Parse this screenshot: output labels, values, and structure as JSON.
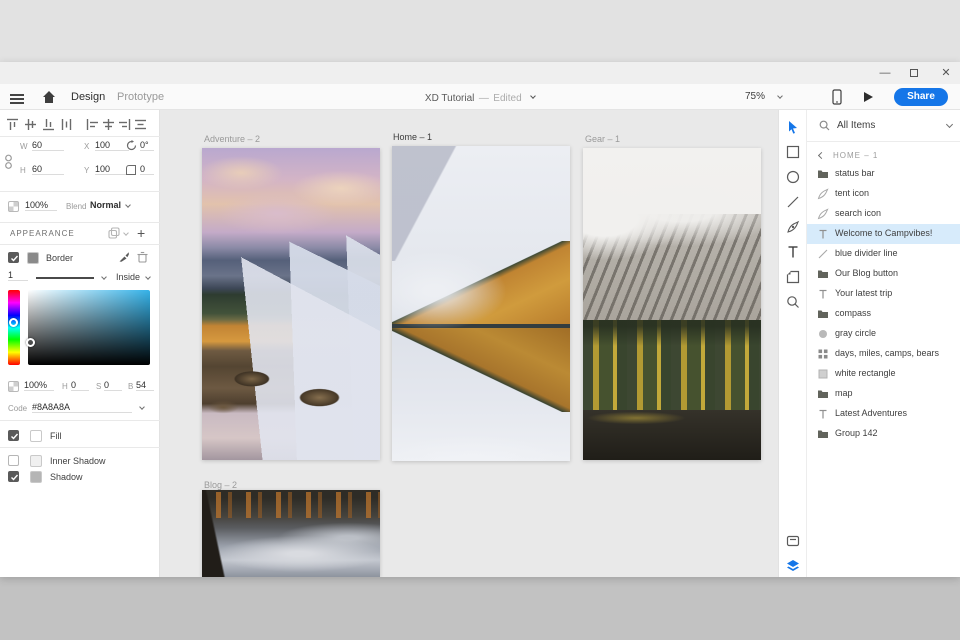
{
  "titlebar": {
    "minimize_glyph": "—",
    "close_glyph": "✕"
  },
  "toolbar": {
    "tabs": [
      {
        "label": "Design"
      },
      {
        "label": "Prototype"
      }
    ],
    "doc_title": "XD Tutorial",
    "doc_separator": "—",
    "doc_status": "Edited",
    "zoom_level": "75%",
    "share_label": "Share"
  },
  "properties": {
    "transform": {
      "w_label": "W",
      "w": "60",
      "x_label": "X",
      "x": "100",
      "h_label": "H",
      "h": "60",
      "y_label": "Y",
      "y": "100",
      "rotation": "0°",
      "radius": "0"
    },
    "opacity": "100%",
    "blend_label": "Blend",
    "blend_value": "Normal",
    "appearance_title": "APPEARANCE",
    "border": {
      "label": "Border",
      "width": "1",
      "position": "Inside"
    },
    "color": {
      "alpha": "100%",
      "h_label": "H",
      "h_value": "0",
      "s_label": "S",
      "s_value": "0",
      "b_label": "B",
      "b_value": "54",
      "code_label": "Code",
      "code_value": "#8A8A8A"
    },
    "effects": [
      {
        "label": "Fill",
        "checked": true
      },
      {
        "label": "Inner Shadow",
        "checked": false
      },
      {
        "label": "Shadow",
        "checked": true
      }
    ]
  },
  "canvas": {
    "artboards": [
      {
        "name": "Adventure – 2"
      },
      {
        "name": "Home – 1",
        "active": true
      },
      {
        "name": "Gear – 1"
      },
      {
        "name": "Blog – 2"
      }
    ]
  },
  "tools": [
    "select",
    "rectangle",
    "ellipse",
    "line",
    "pen",
    "text",
    "artboard",
    "zoom",
    "plugins",
    "layers"
  ],
  "layers_panel": {
    "filter_label": "All Items",
    "group_label": "HOME – 1",
    "items": [
      {
        "icon": "folder-icon",
        "label": "status bar"
      },
      {
        "icon": "path-icon",
        "label": "tent icon"
      },
      {
        "icon": "path-icon",
        "label": "search icon"
      },
      {
        "icon": "text-icon",
        "label": "Welcome to Campvibes!",
        "selected": true
      },
      {
        "icon": "line-icon",
        "label": "blue divider line"
      },
      {
        "icon": "folder-icon",
        "label": "Our Blog button"
      },
      {
        "icon": "text-icon",
        "label": "Your latest trip"
      },
      {
        "icon": "folder-icon",
        "label": "compass"
      },
      {
        "icon": "circle-icon",
        "label": "gray circle"
      },
      {
        "icon": "group-icon",
        "label": "days, miles, camps, bears"
      },
      {
        "icon": "square-icon",
        "label": "white rectangle"
      },
      {
        "icon": "folder-icon",
        "label": "map"
      },
      {
        "icon": "text-icon",
        "label": "Latest Adventures"
      },
      {
        "icon": "folder-icon",
        "label": "Group 142"
      }
    ]
  },
  "colors": {
    "accent": "#1576E8",
    "selection_bg": "#D7EBFB",
    "canvas_bg": "#E9E9E9",
    "current_color": "#8A8A8A"
  }
}
